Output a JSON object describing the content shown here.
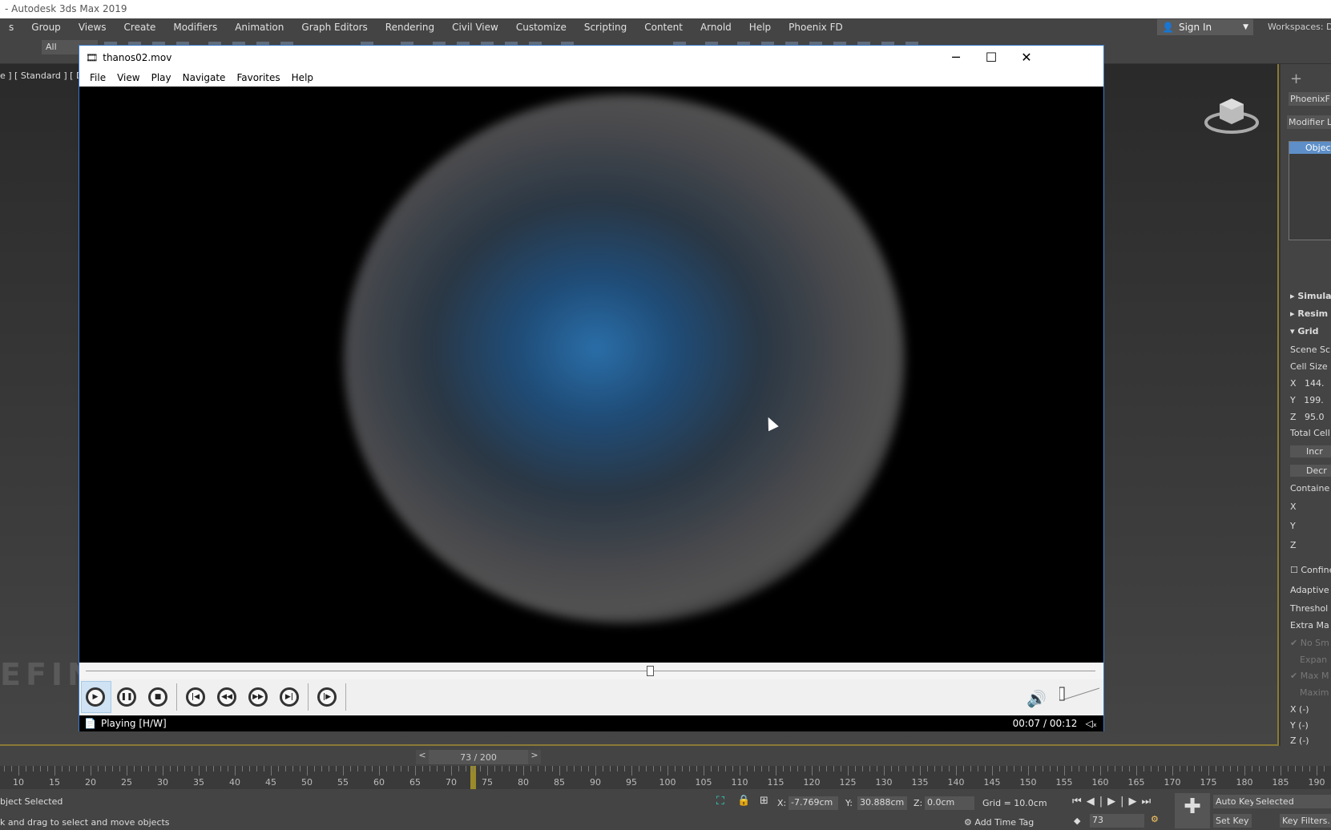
{
  "app": {
    "title": "- Autodesk 3ds Max 2019"
  },
  "menu": [
    "s",
    "Group",
    "Views",
    "Create",
    "Modifiers",
    "Animation",
    "Graph Editors",
    "Rendering",
    "Civil View",
    "Customize",
    "Scripting",
    "Content",
    "Arnold",
    "Help",
    "Phoenix FD"
  ],
  "signin": {
    "label": "Sign In",
    "icon": "user-icon"
  },
  "workspaces": "Workspaces: D",
  "toolbar": {
    "selection_filter": "All"
  },
  "viewport": {
    "label": "e ] [ Standard ] [ Defa",
    "watermark": "EFINE"
  },
  "right_panel": {
    "object_name": "PhoenixFD",
    "modifier_list": "Modifier Lis",
    "stack_item": "Object",
    "rollouts": [
      "Simula",
      "Resim",
      "Grid"
    ],
    "grid": {
      "scene_scale": "Scene Sc",
      "cell_size": "Cell Size",
      "x": "144.",
      "y": "199.",
      "z": "95.0",
      "total_cells": "Total Cell",
      "increase": "Incr",
      "decrease": "Decr",
      "container": "Containe",
      "confine": "Confine",
      "adaptive": "Adaptive",
      "threshold": "Threshol",
      "extra_margin": "Extra Ma",
      "no_smooth": "No Sm",
      "expand": "Expan",
      "max_m": "Max M",
      "maxim": "Maxim",
      "xn": "X (-)",
      "yn": "Y (-)",
      "zn": "Z (-)"
    }
  },
  "player": {
    "title": "thanos02.mov",
    "menu": [
      "File",
      "View",
      "Play",
      "Navigate",
      "Favorites",
      "Help"
    ],
    "status": "Playing [H/W]",
    "time": "00:07 / 00:12",
    "progress": 0.583,
    "volume": 0.0,
    "accent": "#3a7ac8"
  },
  "timeline": {
    "frame_display": "73 / 200",
    "current_frame": 73,
    "ruler_start": 10,
    "ruler_end": 190,
    "ruler_step": 5,
    "prev": "<",
    "next": ">"
  },
  "statusbar": {
    "selection": "bject Selected",
    "prompt": "k and drag to select and move objects",
    "x_label": "X:",
    "x": "-7.769cm",
    "y_label": "Y:",
    "y": "30.888cm",
    "z_label": "Z:",
    "z": "0.0cm",
    "grid": "Grid = 10.0cm",
    "add_time_tag": "Add Time Tag",
    "frame": "73",
    "auto_key": "Auto Key",
    "set_key": "Set Key",
    "key_mode": "Selected",
    "key_filters": "Key Filters..."
  }
}
